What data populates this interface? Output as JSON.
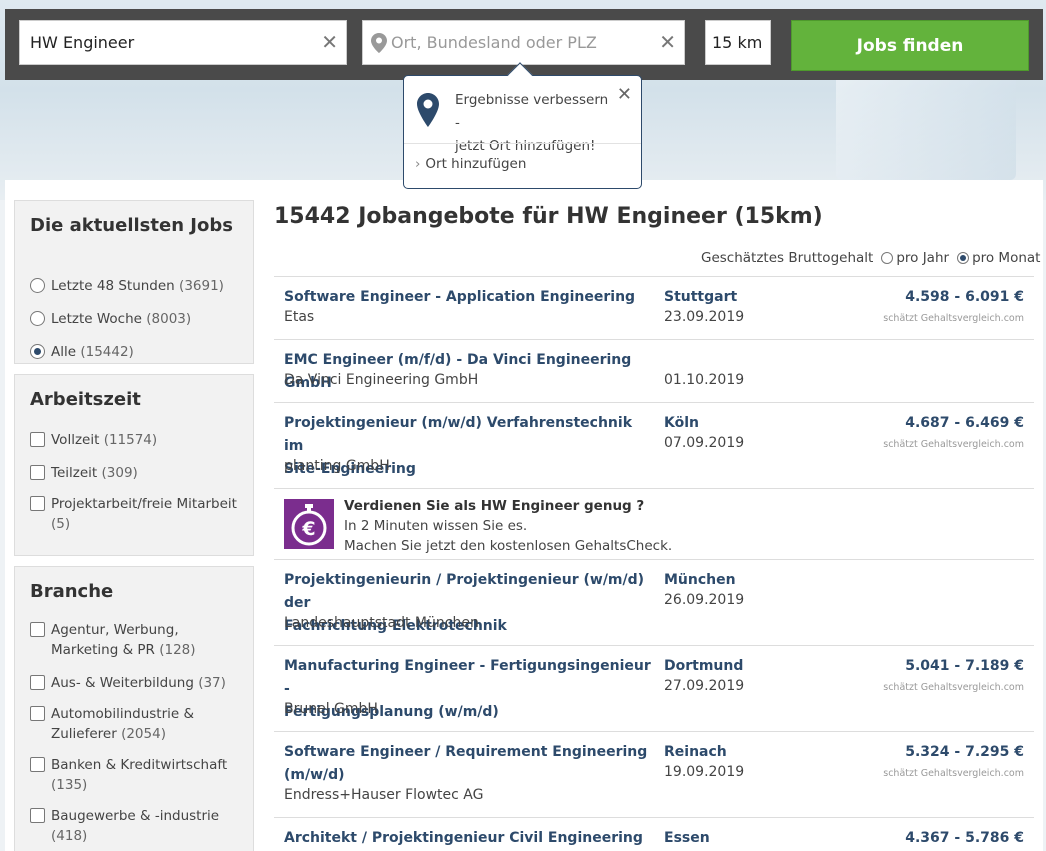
{
  "search": {
    "what_value": "HW Engineer",
    "where_placeholder": "Ort, Bundesland oder PLZ",
    "radius": "15 km",
    "button": "Jobs finden"
  },
  "tooltip": {
    "line1": "Ergebnisse verbessern -",
    "line2": "jetzt Ort hinzufügen!",
    "link": "Ort hinzufügen"
  },
  "filters": {
    "recent": {
      "title": "Die aktuellsten Jobs",
      "options": [
        {
          "label": "Letzte 48 Stunden",
          "count": "(3691)",
          "selected": false
        },
        {
          "label": "Letzte Woche",
          "count": "(8003)",
          "selected": false
        },
        {
          "label": "Alle",
          "count": "(15442)",
          "selected": true
        }
      ]
    },
    "worktime": {
      "title": "Arbeitszeit",
      "options": [
        {
          "label": "Vollzeit",
          "count": "(11574)"
        },
        {
          "label": "Teilzeit",
          "count": "(309)"
        },
        {
          "label1": "Projektarbeit/freie Mitarbeit",
          "count": "(5)"
        }
      ]
    },
    "branch": {
      "title": "Branche",
      "options": [
        {
          "label1": "Agentur, Werbung,",
          "label2": "Marketing & PR",
          "count": "(128)"
        },
        {
          "label": "Aus- & Weiterbildung",
          "count": "(37)"
        },
        {
          "label1": "Automobilindustrie &",
          "label2": "Zulieferer",
          "count": "(2054)"
        },
        {
          "label1": "Banken & Kreditwirtschaft",
          "count": "(135)"
        },
        {
          "label1": "Baugewerbe & -industrie",
          "count": "(418)"
        }
      ]
    }
  },
  "results": {
    "title": "15442 Jobangebote für HW Engineer (15km)",
    "salary_label": "Geschätztes Bruttogehalt",
    "salary_year": "pro Jahr",
    "salary_month": "pro Monat",
    "source": "schätzt Gehaltsvergleich.com",
    "jobs": [
      {
        "title1": "Software Engineer - Application Engineering",
        "company": "Etas",
        "location": "Stuttgart",
        "date": "23.09.2019",
        "salary": "4.598 - 6.091 €"
      },
      {
        "title1": "EMC Engineer (m/f/d) - Da Vinci Engineering GmbH",
        "company": "Da Vinci Engineering GmbH",
        "location": "",
        "date": "01.10.2019",
        "salary": ""
      },
      {
        "title1": "Projektingenieur (m/w/d) Verfahrenstechnik im",
        "title2": "Site-Engineering",
        "company": "planting GmbH",
        "location": "Köln",
        "date": "07.09.2019",
        "salary": "4.687 - 6.469 €"
      },
      {
        "title1": "Projektingenieurin / Projektingenieur (w/m/d) der",
        "title2": "Fachrichtung Elektrotechnik",
        "company": "Landeshauptstadt München",
        "location": "München",
        "date": "26.09.2019",
        "salary": ""
      },
      {
        "title1": "Manufacturing Engineer - Fertigungsingenieur -",
        "title2": "Fertigungsplanung (w/m/d)",
        "company": "Brunel GmbH",
        "location": "Dortmund",
        "date": "27.09.2019",
        "salary": "5.041 - 7.189 €"
      },
      {
        "title1": "Software Engineer / Requirement Engineering",
        "title2": "(m/w/d)",
        "company": "Endress+Hauser Flowtec AG",
        "location": "Reinach",
        "date": "19.09.2019",
        "salary": "5.324 - 7.295 €"
      },
      {
        "title1": "Architekt / Projektingenieur Civil Engineering",
        "company": "",
        "location": "Essen",
        "date": "",
        "salary": "4.367 - 5.786 €"
      }
    ],
    "promo": {
      "title": "Verdienen Sie als HW Engineer genug ?",
      "line1": "In 2 Minuten wissen Sie es.",
      "line2": "Machen Sie jetzt den kostenlosen GehaltsCheck."
    }
  }
}
